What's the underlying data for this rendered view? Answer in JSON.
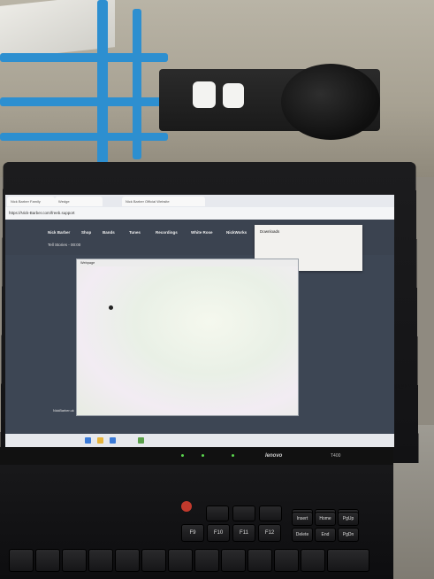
{
  "browser": {
    "tabs": [
      "Nick Barber Family",
      "Wedge",
      "Nick Barber Official Website"
    ],
    "url": "https://Nick-Barber.com/freeb.support"
  },
  "site": {
    "nav": [
      "Nick Barber",
      "Shop",
      "Bands",
      "Tunes",
      "Recordings",
      "White Rose",
      "NickWorks"
    ],
    "subnav": "Tell Stories - 00:00",
    "footer": "NickBarber.uk"
  },
  "download_panel": {
    "title": "Downloads"
  },
  "dialog": {
    "title": "Webpage"
  },
  "laptop": {
    "brand": "lenovo",
    "model": "T400"
  },
  "keyboard": {
    "keys": [
      "F9",
      "F10",
      "F11",
      "F12",
      "Insert",
      "Home",
      "PgUp",
      "Delete",
      "End",
      "PgDn"
    ]
  }
}
